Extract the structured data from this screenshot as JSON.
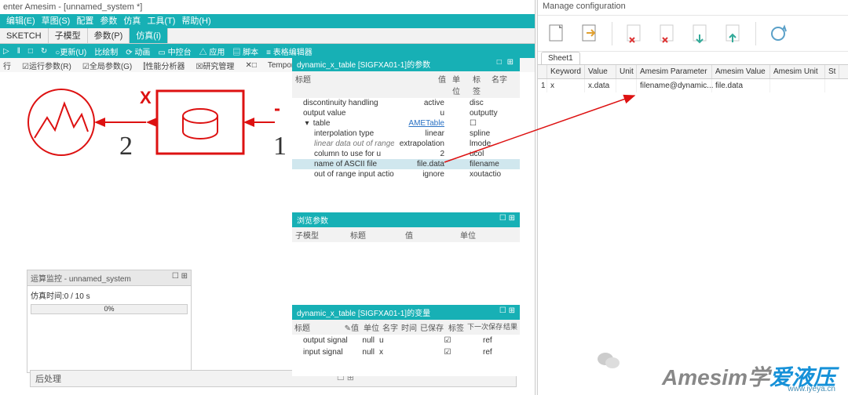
{
  "window": {
    "title": "enter Amesim - [unnamed_system *]"
  },
  "menu": {
    "items": [
      "编辑(E)",
      "草图(S)",
      "配置",
      "参数",
      "仿真",
      "工具(T)",
      "帮助(H)"
    ]
  },
  "tabs": {
    "items": [
      "SKETCH",
      "子模型",
      "参数(P)",
      "仿真(i)"
    ],
    "active": 3
  },
  "toolbar": {
    "items": [
      "▷",
      "‖",
      "□",
      "↻",
      "○更新(U)",
      "比绘制",
      "⟳ 动画",
      "▭ 中控台",
      "△ 应用",
      "▤ 脚本",
      "≡ 表格编辑器"
    ]
  },
  "subbar": {
    "items": [
      "行",
      "☑运行参数(R)",
      "☑全局参数(G)",
      "⫿性能分析器",
      "☒研究管理",
      "✕□",
      "Temporal analysis"
    ]
  },
  "system": {
    "name": "unnamed_system *"
  },
  "diagram": {
    "port_left": "2",
    "port_right": "1",
    "x_label": "X"
  },
  "monitor": {
    "title": "运算监控  - unnamed_system",
    "time_label": "仿真时间:0 / 10 s",
    "progress": "0%"
  },
  "postproc": {
    "title": "后处理"
  },
  "param_panel": {
    "title": "dynamic_x_table [SIGFXA01-1]的参数",
    "tools": "□ ⊞",
    "head": [
      "标题",
      "值",
      "单位",
      "标签",
      "名字"
    ],
    "rows": [
      {
        "t": "discontinuity handling",
        "v": "active",
        "u": "",
        "n": "disc",
        "indent": 1
      },
      {
        "t": "output value",
        "v": "u",
        "u": "",
        "n": "outputty",
        "indent": 1
      },
      {
        "t": "table",
        "v": "AMETable",
        "u": "",
        "n": "☐",
        "indent": 1,
        "link": true,
        "tree": true
      },
      {
        "t": "interpolation type",
        "v": "linear",
        "u": "",
        "n": "spline",
        "indent": 2
      },
      {
        "t": "linear data out of range",
        "v": "extrapolation",
        "u": "",
        "n": "lmode",
        "indent": 2,
        "italic": true
      },
      {
        "t": "column to use for u",
        "v": "2",
        "u": "",
        "n": "ucol",
        "indent": 2
      },
      {
        "t": "name of ASCII file",
        "v": "file.data",
        "u": "",
        "n": "filename",
        "indent": 2,
        "sel": true
      },
      {
        "t": "out of range input action",
        "v": "ignore",
        "u": "",
        "n": "xoutactio",
        "indent": 2
      }
    ]
  },
  "browse_panel": {
    "title": "浏览参数",
    "head": [
      "子模型",
      "标题",
      "值",
      "单位"
    ]
  },
  "var_panel": {
    "title": "dynamic_x_table [SIGFXA01-1]的变量",
    "head": [
      "标题",
      "✎值",
      "单位",
      "名字",
      "时间",
      "已保存",
      "标签",
      "下一次保存",
      "结果"
    ],
    "rows": [
      {
        "t": "output signal",
        "v": "null",
        "u": "u",
        "saved": "☑",
        "next": "ref"
      },
      {
        "t": "input signal",
        "v": "null",
        "u": "x",
        "saved": "☑",
        "next": "ref"
      }
    ]
  },
  "config": {
    "title": "Manage configuration",
    "sheet": "Sheet1",
    "head": [
      "",
      "Keyword",
      "Value",
      "Unit",
      "Amesim Parameter",
      "Amesim Value",
      "Amesim Unit",
      "St"
    ],
    "row": {
      "idx": "1",
      "kw": "x",
      "val": "x.data",
      "unit": "",
      "ap": "filename@dynamic...",
      "av": "file.data",
      "au": ""
    }
  },
  "watermark": {
    "cn": "爱液压",
    "gray": "Amesim学",
    "url": "www.iyeya.cn"
  }
}
